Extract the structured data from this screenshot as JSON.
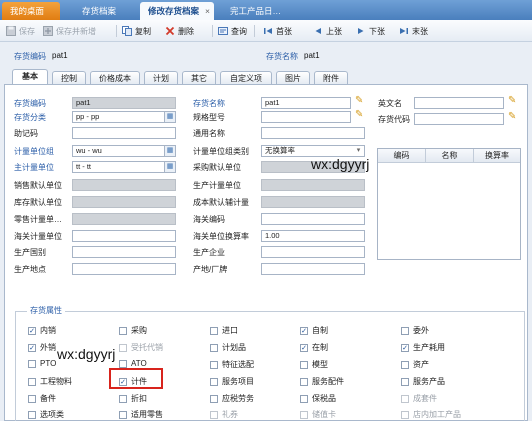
{
  "tabs": [
    {
      "label": "我的桌面"
    },
    {
      "label": "存货档案"
    },
    {
      "label": "修改存货档案"
    },
    {
      "label": "完工产品日…"
    }
  ],
  "tab_close": "×",
  "toolbar": {
    "save": "保存",
    "save_new": "保存并新增",
    "copy": "复制",
    "delete": "删除",
    "query": "查询",
    "first": "首张",
    "prev": "上张",
    "next": "下张",
    "last": "末张"
  },
  "header": {
    "code_label": "存货编码",
    "code_value": "pat1",
    "name_label": "存货名称",
    "name_value": "pat1"
  },
  "form_tabs": [
    "基本",
    "控制",
    "价格成本",
    "计划",
    "其它",
    "自定义项",
    "图片",
    "附件"
  ],
  "left_fields": [
    {
      "label": "存货编码",
      "value": "pat1"
    },
    {
      "label": "存货分类",
      "value": "pp - pp"
    },
    {
      "label": "助记码",
      "value": ""
    },
    {
      "label": "计量单位组",
      "value": "wu - wu"
    },
    {
      "label": "主计量单位",
      "value": "tt - tt"
    },
    {
      "label": "销售默认单位",
      "value": ""
    },
    {
      "label": "库存默认单位",
      "value": ""
    },
    {
      "label": "零售计量单…",
      "value": ""
    },
    {
      "label": "海关计量单位",
      "value": ""
    },
    {
      "label": "生产国别",
      "value": ""
    },
    {
      "label": "生产地点",
      "value": ""
    }
  ],
  "mid_fields": [
    {
      "label": "存货名称",
      "value": "pat1"
    },
    {
      "label": "规格型号",
      "value": ""
    },
    {
      "label": "通用名称",
      "value": ""
    },
    {
      "label": "计量单位组类别",
      "value": "无换算率"
    },
    {
      "label": "采购默认单位",
      "value": ""
    },
    {
      "label": "生产计量单位",
      "value": ""
    },
    {
      "label": "成本默认辅计量",
      "value": ""
    },
    {
      "label": "海关编码",
      "value": ""
    },
    {
      "label": "海关单位换算率",
      "value": "1.00"
    },
    {
      "label": "生产企业",
      "value": ""
    },
    {
      "label": "产地/厂牌",
      "value": ""
    }
  ],
  "right_fields": [
    {
      "label": "英文名",
      "value": ""
    },
    {
      "label": "存货代码",
      "value": ""
    }
  ],
  "grid_headers": [
    "编码",
    "名称",
    "换算率"
  ],
  "attr_title": "存货属性",
  "attributes": [
    [
      {
        "label": "内销",
        "checked": true,
        "disabled": false
      },
      {
        "label": "外销",
        "checked": true,
        "disabled": false
      },
      {
        "label": "PTO",
        "checked": false,
        "disabled": false
      },
      {
        "label": "工程物料",
        "checked": false,
        "disabled": false
      },
      {
        "label": "备件",
        "checked": false,
        "disabled": false
      },
      {
        "label": "选项类",
        "checked": false,
        "disabled": false
      }
    ],
    [
      {
        "label": "采购",
        "checked": false,
        "disabled": false
      },
      {
        "label": "受托代销",
        "checked": false,
        "disabled": true
      },
      {
        "label": "ATO",
        "checked": false,
        "disabled": false
      },
      {
        "label": "计件",
        "checked": true,
        "disabled": false
      },
      {
        "label": "折扣",
        "checked": false,
        "disabled": false
      },
      {
        "label": "适用零售",
        "checked": false,
        "disabled": false
      }
    ],
    [
      {
        "label": "进口",
        "checked": false,
        "disabled": false
      },
      {
        "label": "计划品",
        "checked": false,
        "disabled": false
      },
      {
        "label": "特征选配",
        "checked": false,
        "disabled": false
      },
      {
        "label": "服务项目",
        "checked": false,
        "disabled": false
      },
      {
        "label": "应税劳务",
        "checked": false,
        "disabled": false
      },
      {
        "label": "礼券",
        "checked": false,
        "disabled": true
      }
    ],
    [
      {
        "label": "自制",
        "checked": true,
        "disabled": false
      },
      {
        "label": "在制",
        "checked": true,
        "disabled": false
      },
      {
        "label": "模型",
        "checked": false,
        "disabled": false
      },
      {
        "label": "服务配件",
        "checked": false,
        "disabled": false
      },
      {
        "label": "保税品",
        "checked": false,
        "disabled": false
      },
      {
        "label": "储值卡",
        "checked": false,
        "disabled": true
      }
    ],
    [
      {
        "label": "委外",
        "checked": false,
        "disabled": false
      },
      {
        "label": "生产耗用",
        "checked": true,
        "disabled": false
      },
      {
        "label": "资产",
        "checked": false,
        "disabled": false
      },
      {
        "label": "服务产品",
        "checked": false,
        "disabled": false
      },
      {
        "label": "成套件",
        "checked": false,
        "disabled": true
      },
      {
        "label": "店内加工产品",
        "checked": false,
        "disabled": true
      }
    ]
  ],
  "watermark": "wx:dgyyrj",
  "colors": {
    "accent": "#2b5ea8",
    "highlight": "#d8241d",
    "home_tab": "#e98a1d"
  }
}
